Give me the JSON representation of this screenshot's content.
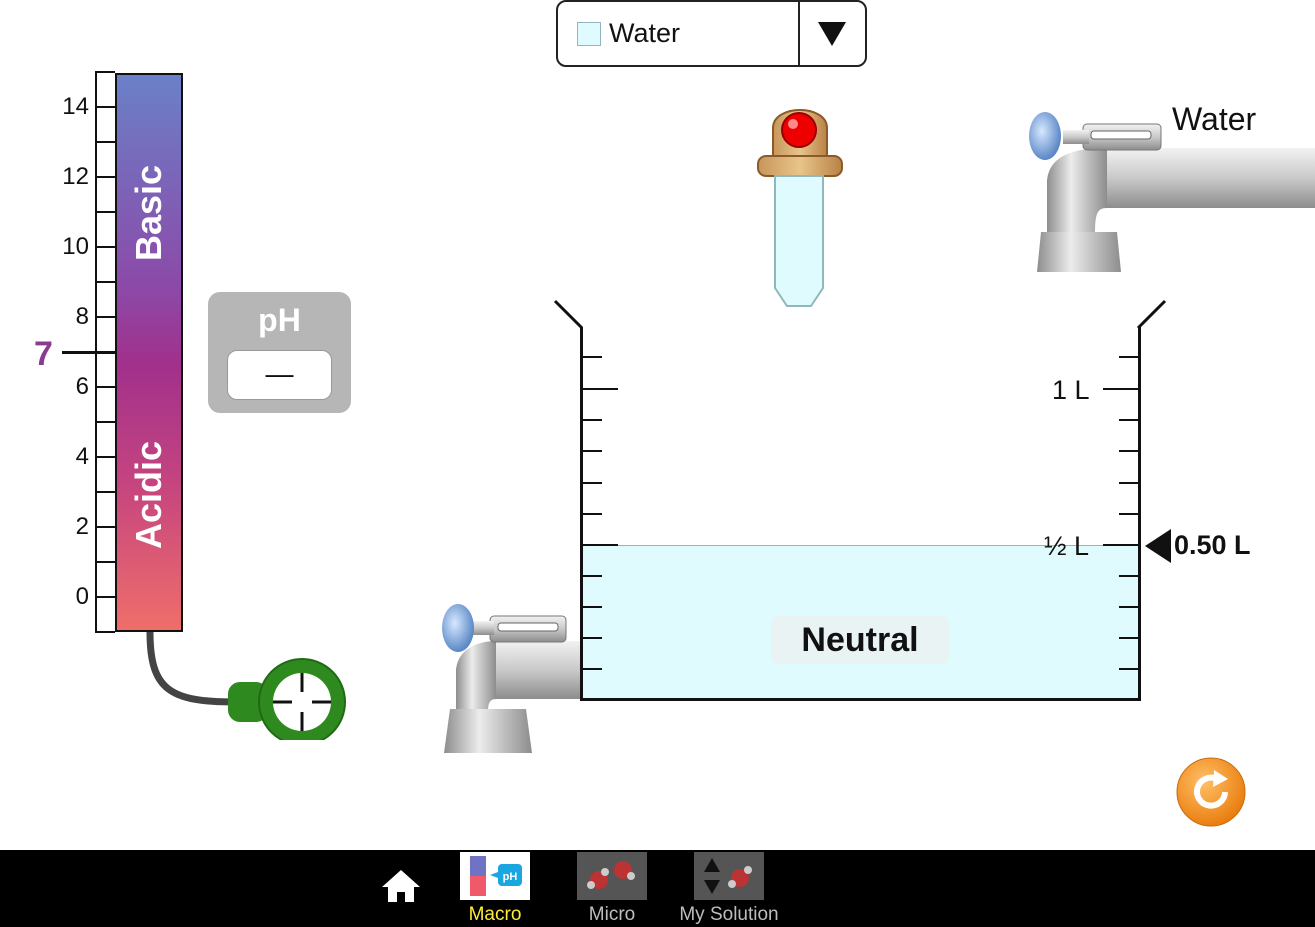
{
  "solute_selector": {
    "selected": "Water",
    "swatch_color": "#e0fbfd",
    "icon": "dropdown-arrow-icon"
  },
  "ph_scale": {
    "ticks": [
      "14",
      "12",
      "10",
      "8",
      "6",
      "4",
      "2",
      "0"
    ],
    "basic_label": "Basic",
    "acidic_label": "Acidic",
    "neutral_value": "7",
    "neutral_color": "#8a3a91"
  },
  "ph_meter": {
    "title": "pH",
    "readout": "—",
    "probe_color": "#2e8a1f"
  },
  "beaker": {
    "label_1l": "1 L",
    "label_half": "½ L",
    "status": "Neutral",
    "volume": "0.50 L",
    "volume_fraction": 0.5,
    "water_color": "#e0fbfd"
  },
  "faucets": {
    "top_label": "Water"
  },
  "navbar": {
    "tabs": [
      {
        "label": "Macro",
        "active": true
      },
      {
        "label": "Micro",
        "active": false
      },
      {
        "label": "My Solution",
        "active": false
      }
    ],
    "home_icon": "home-icon"
  },
  "reset": {
    "icon": "reset-icon",
    "color": "#f7941d"
  }
}
